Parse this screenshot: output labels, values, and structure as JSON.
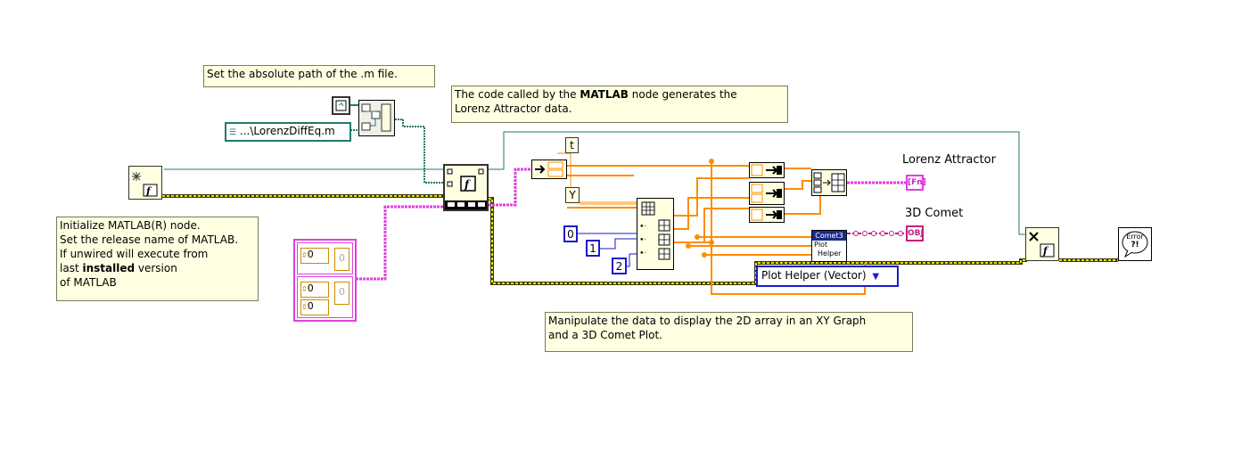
{
  "comments": {
    "path_comment": "Set the absolute path of the .m file.",
    "matlab_comment_line1_pre": "The code called by the ",
    "matlab_comment_line1_bold": "MATLAB",
    "matlab_comment_line1_post": " node generates the",
    "matlab_comment_line2": "Lorenz Attractor data.",
    "init_line1": "Initialize MATLAB(R) node.",
    "init_line2": "Set the release name of MATLAB.",
    "init_line3": "If unwired will execute from",
    "init_line4_pre": "last ",
    "init_line4_bold": "installed",
    "init_line4_post": " version",
    "init_line5": "of MATLAB",
    "manip_line1": "Manipulate the data to display the 2D array in an XY Graph",
    "manip_line2": "and a 3D Comet Plot."
  },
  "path_constant": "...\\LorenzDiffEq.m",
  "labels": {
    "t": "t",
    "y": "Y",
    "lorenz": "Lorenz Attractor",
    "comet": "3D Comet"
  },
  "indices": [
    "0",
    "1",
    "2"
  ],
  "array_values": {
    "top_index": "0",
    "top_value": "0",
    "mid_index": "0",
    "mid_value": "0",
    "bottom_index": "0"
  },
  "indicators": {
    "xy_graph": "[Fn]",
    "comet_ref": "OBJ"
  },
  "comet_node": {
    "title": "Comet3",
    "line1": "Plot",
    "line2": "Helper"
  },
  "ring_selection": "Plot Helper (Vector)",
  "error_node": {
    "line1": "Error",
    "line2": "?!"
  },
  "colors": {
    "background": "#ffffff",
    "comment_bg": "#ffffe1",
    "error_wire": "#c8c800",
    "orange_wire": "#ff8c00",
    "pink_wire": "#e040e0",
    "teal_wire": "#1f7a6b",
    "blue_wire": "#1a1acc"
  }
}
